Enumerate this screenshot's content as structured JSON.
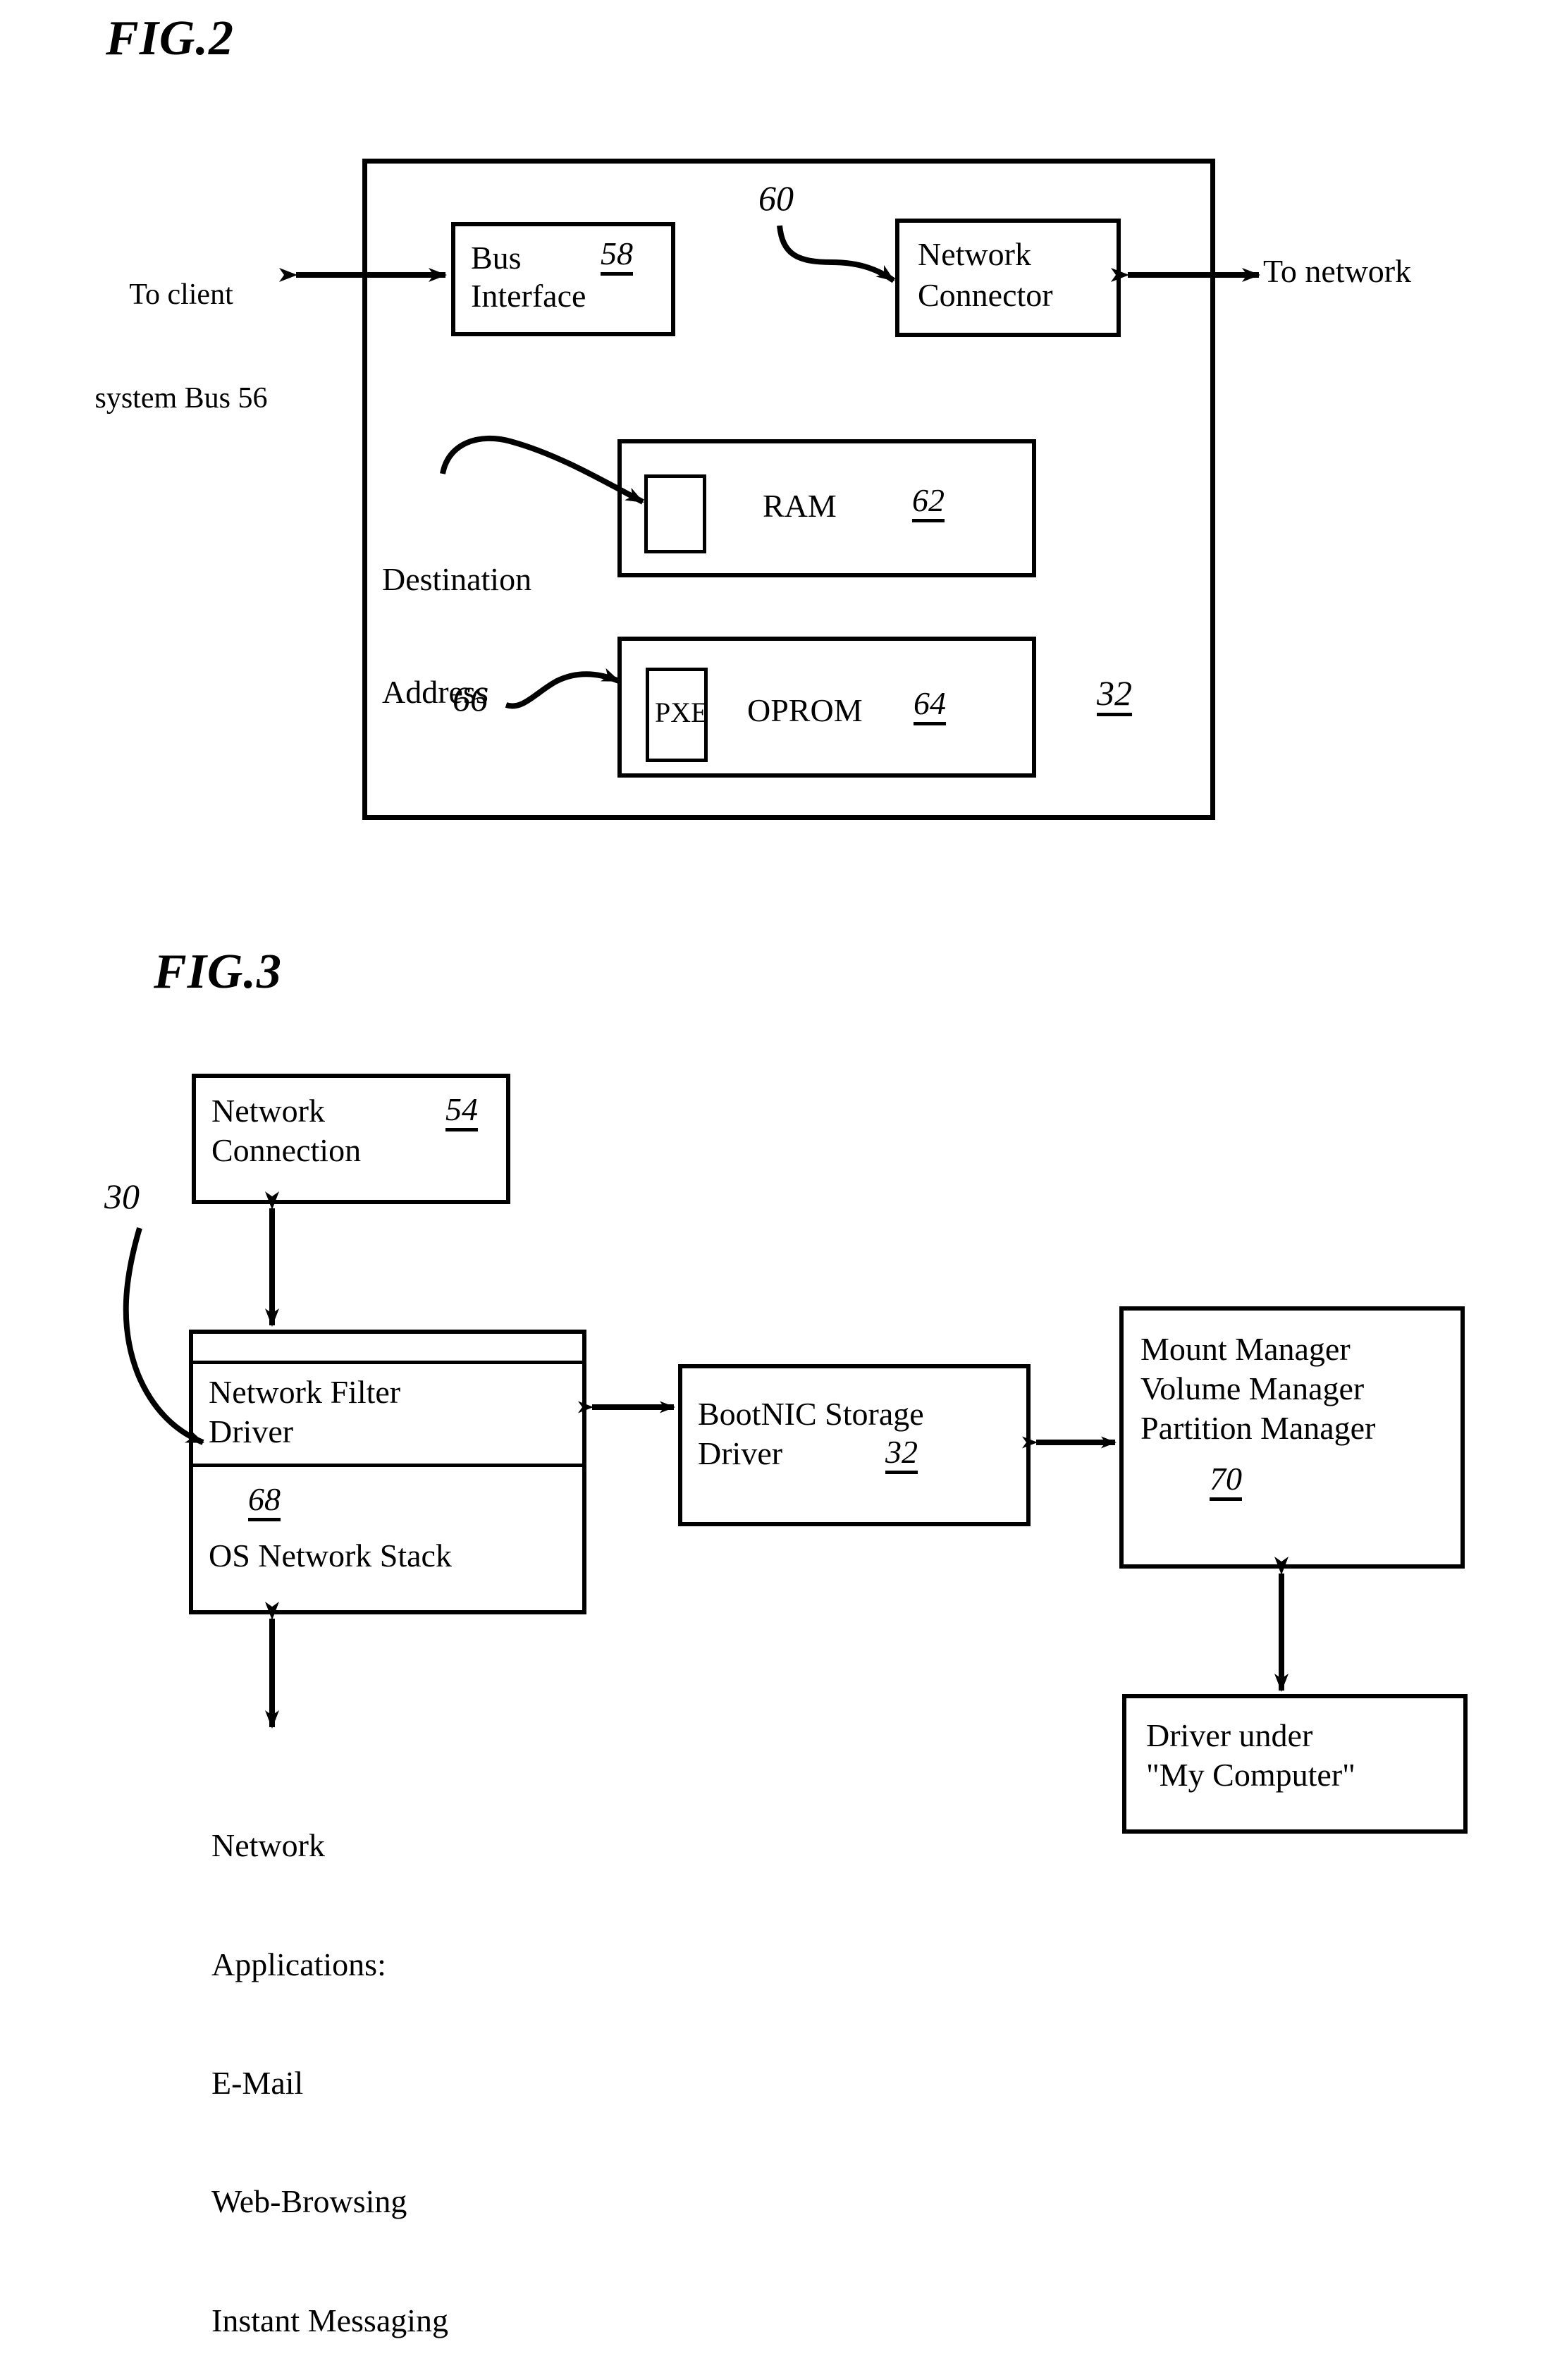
{
  "figures": [
    {
      "title": "FIG.2",
      "outer_ref": "32",
      "left_label": {
        "line1": "To client",
        "line2": "system Bus 56"
      },
      "right_label": "To network",
      "boxes": {
        "bus_interface": {
          "line1": "Bus",
          "line2": "Interface",
          "ref": "58"
        },
        "network_connector": {
          "line1": "Network",
          "line2": "Connector",
          "ref": "60"
        },
        "ram": {
          "label": "RAM",
          "ref": "62",
          "inner_label": ""
        },
        "oprom": {
          "label": "OPROM",
          "ref": "64",
          "inner_label": "PXE",
          "inner_ref": "66"
        }
      },
      "callouts": {
        "destination_address": {
          "line1": "Destination",
          "line2": "Address"
        },
        "network_connector_ref": "60",
        "pxe_ref": "66"
      }
    },
    {
      "title": "FIG.3",
      "diagram_ref": "30",
      "boxes": {
        "network_connection": {
          "line1": "Network",
          "line2": "Connection",
          "ref": "54"
        },
        "network_filter_driver": {
          "line1": "Network Filter",
          "line2": "Driver",
          "ref": "68",
          "stack_label": "OS Network Stack"
        },
        "bootnic_storage_driver": {
          "line1": "BootNIC Storage",
          "line2": "Driver",
          "ref": "32"
        },
        "managers": {
          "line1": "Mount Manager",
          "line2": "Volume Manager",
          "line3": "Partition Manager",
          "ref": "70"
        },
        "driver_my_computer": {
          "line1": "Driver under",
          "line2": "\"My Computer\""
        }
      },
      "network_applications": {
        "line1": "Network",
        "line2": "Applications:",
        "line3": "E-Mail",
        "line4": "Web-Browsing",
        "line5": "Instant Messaging"
      }
    }
  ],
  "colors": {
    "ink": "#000000",
    "paper": "#ffffff"
  }
}
